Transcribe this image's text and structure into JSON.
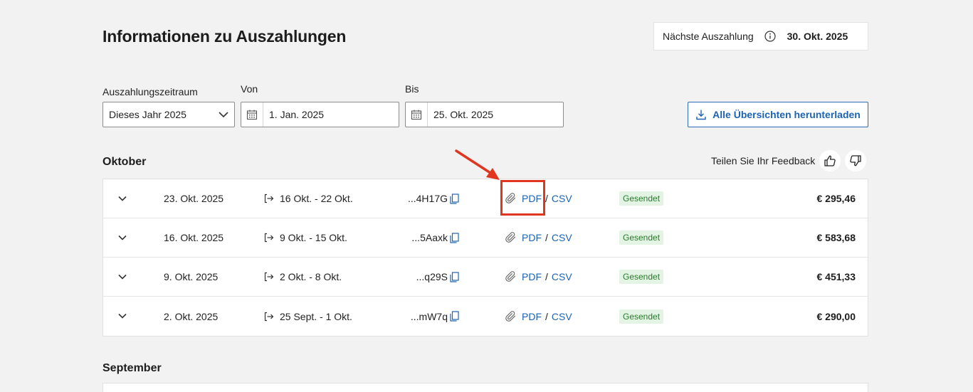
{
  "page": {
    "title": "Informationen zu Auszahlungen"
  },
  "next_payout": {
    "label": "Nächste Auszahlung",
    "date": "30. Okt. 2025"
  },
  "filters": {
    "period_label": "Auszahlungszeitraum",
    "period_value": "Dieses Jahr 2025",
    "from_label": "Von",
    "from_value": "1. Jan. 2025",
    "to_label": "Bis",
    "to_value": "25. Okt. 2025",
    "download_label": "Alle Übersichten herunterladen"
  },
  "feedback": {
    "label": "Teilen Sie Ihr Feedback"
  },
  "sections": [
    {
      "title": "Oktober",
      "rows": [
        {
          "date": "23. Okt. 2025",
          "period": "16 Okt. - 22 Okt.",
          "ref": "...4H17G",
          "pdf": "PDF",
          "sep": "/",
          "csv": "CSV",
          "status": "Gesendet",
          "amount": "€ 295,46"
        },
        {
          "date": "16. Okt. 2025",
          "period": "9 Okt. - 15 Okt.",
          "ref": "...5Aaxk",
          "pdf": "PDF",
          "sep": "/",
          "csv": "CSV",
          "status": "Gesendet",
          "amount": "€ 583,68"
        },
        {
          "date": "9. Okt. 2025",
          "period": "2 Okt. - 8 Okt.",
          "ref": "...q29S",
          "pdf": "PDF",
          "sep": "/",
          "csv": "CSV",
          "status": "Gesendet",
          "amount": "€ 451,33"
        },
        {
          "date": "2. Okt. 2025",
          "period": "25 Sept. - 1 Okt.",
          "ref": "...mW7q",
          "pdf": "PDF",
          "sep": "/",
          "csv": "CSV",
          "status": "Gesendet",
          "amount": "€ 290,00"
        }
      ]
    },
    {
      "title": "September",
      "rows": []
    }
  ],
  "colors": {
    "accent": "#1d63b4",
    "status_bg": "#e4f4e4",
    "status_text": "#267a2b",
    "annotation": "#e0351e"
  },
  "icons": [
    "info-icon",
    "chevron-down-icon",
    "calendar-icon",
    "download-icon",
    "thumbs-up-icon",
    "thumbs-down-icon",
    "expand-chevron-icon",
    "period-arrow-icon",
    "copy-icon",
    "paperclip-icon"
  ]
}
